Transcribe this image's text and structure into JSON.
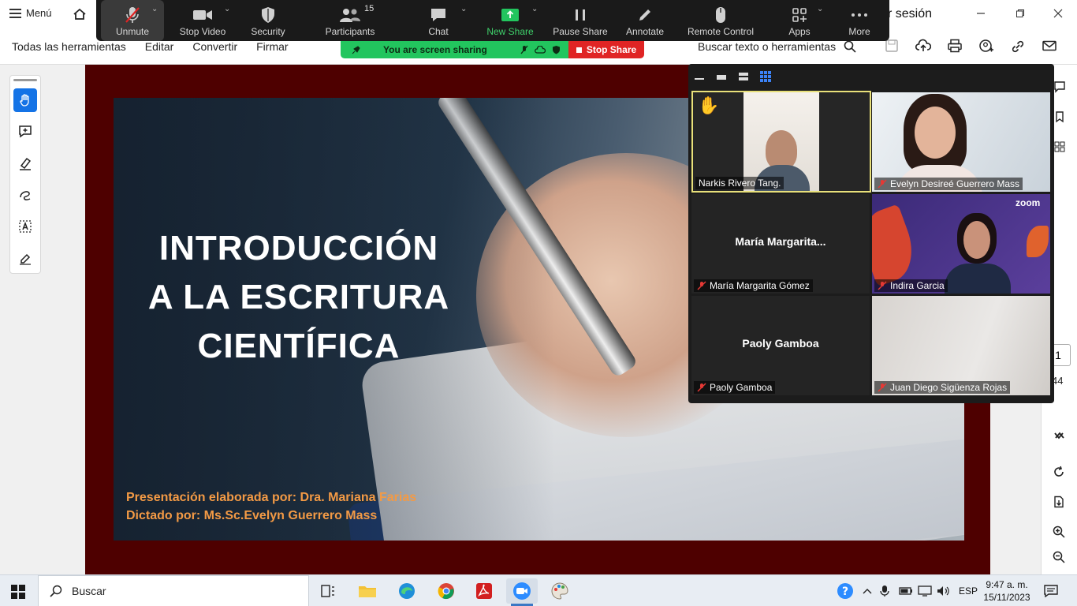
{
  "acrobat": {
    "menu_label": "Menú",
    "signin_partial": "r sesión",
    "tabs": [
      "Todas las herramientas",
      "Editar",
      "Convertir",
      "Firmar"
    ],
    "search_label": "Buscar texto o herramientas",
    "page_current": "1",
    "page_total": "44"
  },
  "zoom_toolbar": {
    "unmute": "Unmute",
    "stop_video": "Stop Video",
    "security": "Security",
    "participants": "Participants",
    "participants_count": "15",
    "chat": "Chat",
    "new_share": "New Share",
    "pause_share": "Pause Share",
    "annotate": "Annotate",
    "remote_control": "Remote Control",
    "apps": "Apps",
    "more": "More"
  },
  "sharing_banner": {
    "status": "You are screen sharing",
    "stop_label": "Stop Share"
  },
  "slide": {
    "title_lines": [
      "INTRODUCCIÓN",
      "A LA ESCRITURA",
      "CIENTÍFICA"
    ],
    "credit_1": "Presentación elaborada por: Dra. Mariana Farias",
    "credit_2": "Dictado por: Ms.Sc.Evelyn Guerrero Mass"
  },
  "gallery": {
    "tiles": [
      {
        "name": "Narkis Rivero Tang.",
        "muted": false,
        "hand_raised": true,
        "video": true
      },
      {
        "name": "Evelyn Desireé Guerrero Mass",
        "muted": true,
        "video": true
      },
      {
        "name": "María Margarita Gómez",
        "center_name": "María  Margarita...",
        "muted": true,
        "video": false
      },
      {
        "name": "Indira Garcia",
        "muted": true,
        "video": true,
        "logo": "zoom"
      },
      {
        "name": "Paoly Gamboa",
        "center_name": "Paoly Gamboa",
        "muted": true,
        "video": false
      },
      {
        "name": "Juan Diego Sigüenza Rojas",
        "muted": true,
        "video": true
      }
    ]
  },
  "taskbar": {
    "search_label": "Buscar",
    "language": "ESP",
    "time": "9:47 a. m.",
    "date": "15/11/2023"
  },
  "colors": {
    "doc_background": "#4e0000",
    "credit_text": "#f39a45",
    "share_green": "#22c55e",
    "stop_red": "#e02424",
    "speaking_border": "#e8e07a"
  }
}
